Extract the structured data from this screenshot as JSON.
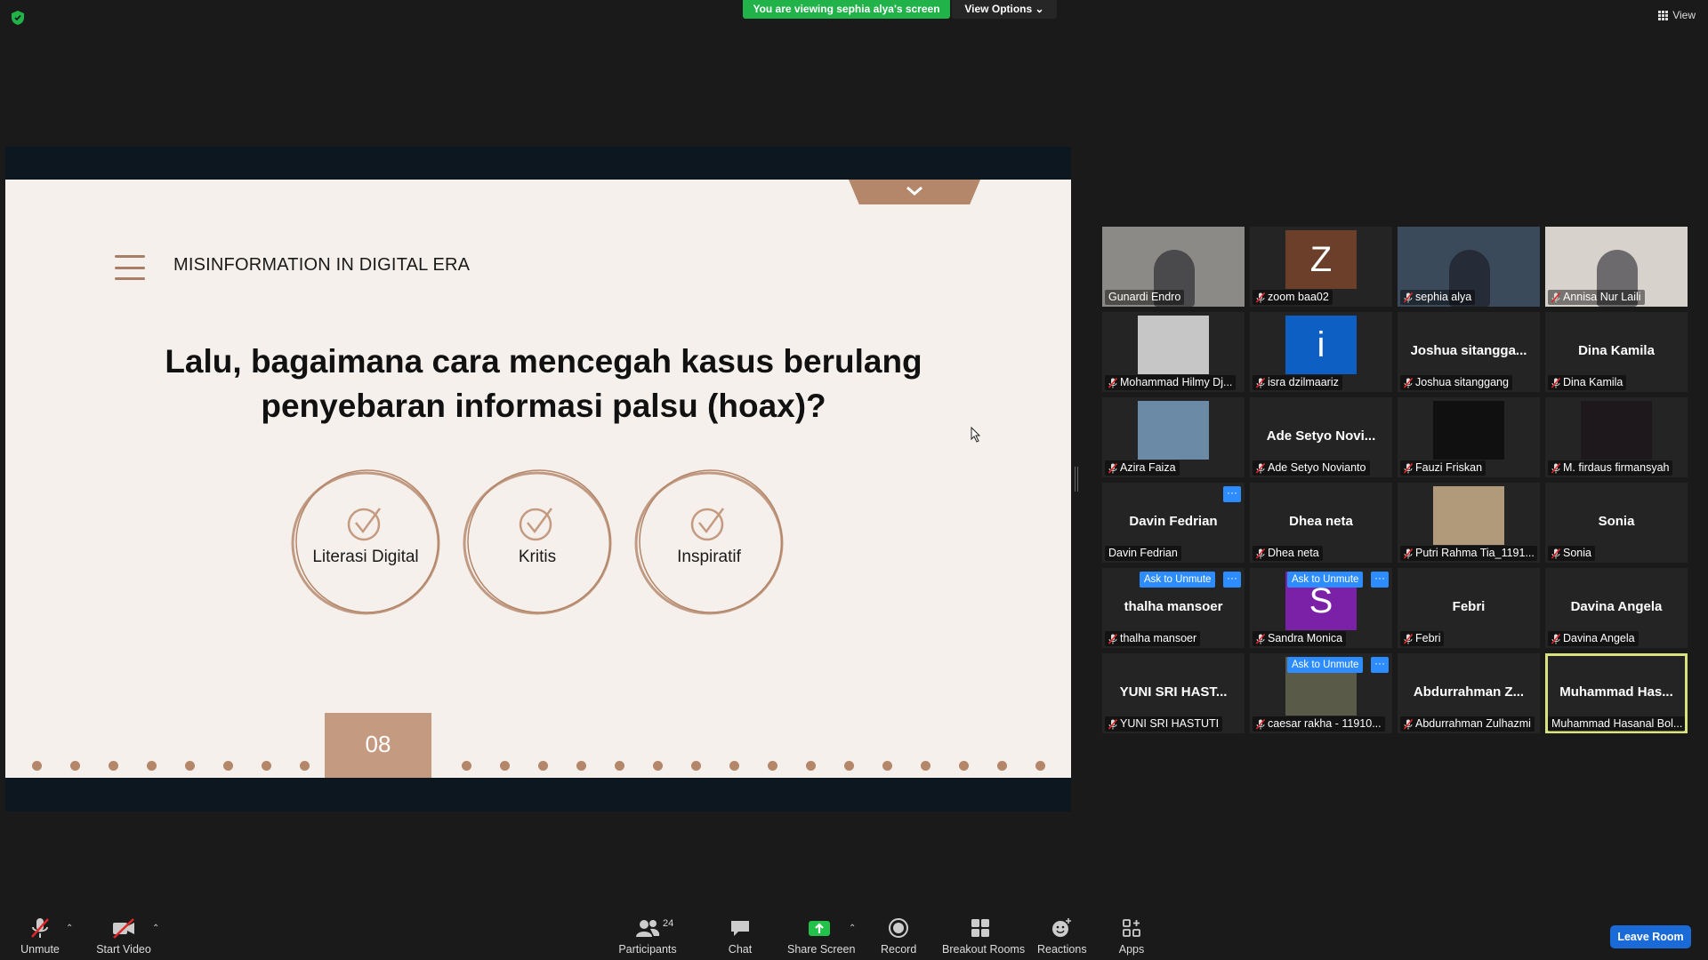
{
  "top_bar": {
    "viewing_banner": "You are viewing sephia alya's screen",
    "view_options": "View Options",
    "view_button": "View"
  },
  "slide": {
    "section_title": "MISINFORMATION IN DIGITAL ERA",
    "heading_line1": "Lalu, bagaimana cara mencegah kasus berulang",
    "heading_line2": "penyebaran informasi palsu (hoax)?",
    "options": [
      "Literasi Digital",
      "Kritis",
      "Inspiratif"
    ],
    "page_number": "08",
    "accent_color": "#b4876a"
  },
  "participants": [
    {
      "tile_name": "",
      "label": "Gunardi Endro",
      "muted": false,
      "video": true
    },
    {
      "tile_name": "",
      "label": "zoom baa02",
      "muted": true,
      "avatar_letter": "Z",
      "avatar_color": "#6b3f2a"
    },
    {
      "tile_name": "",
      "label": "sephia alya",
      "muted": true,
      "video": true
    },
    {
      "tile_name": "",
      "label": "Annisa Nur Laili",
      "muted": true,
      "video": true
    },
    {
      "tile_name": "",
      "label": "Mohammad Hilmy Dj...",
      "muted": true,
      "photo": true
    },
    {
      "tile_name": "",
      "label": "isra dzilmaariz",
      "muted": true,
      "avatar_letter": "i",
      "avatar_color": "#0e5fc4"
    },
    {
      "tile_name": "Joshua  sitangga...",
      "label": "Joshua sitanggang",
      "muted": true
    },
    {
      "tile_name": "Dina Kamila",
      "label": "Dina Kamila",
      "muted": true
    },
    {
      "tile_name": "",
      "label": "Azira Faiza",
      "muted": true,
      "photo": true
    },
    {
      "tile_name": "Ade Setyo Novi...",
      "label": "Ade Setyo Novianto",
      "muted": true
    },
    {
      "tile_name": "",
      "label": "Fauzi Friskan",
      "muted": true,
      "photo": true
    },
    {
      "tile_name": "",
      "label": "M. firdaus firmansyah",
      "muted": true,
      "photo": true
    },
    {
      "tile_name": "Davin Fedrian",
      "label": "Davin Fedrian",
      "muted": false,
      "more": true
    },
    {
      "tile_name": "Dhea neta",
      "label": "Dhea neta",
      "muted": true
    },
    {
      "tile_name": "",
      "label": "Putri Rahma Tia_1191...",
      "muted": true,
      "photo": true
    },
    {
      "tile_name": "Sonia",
      "label": "Sonia",
      "muted": true
    },
    {
      "tile_name": "thalha mansoer",
      "label": "thalha mansoer",
      "muted": true,
      "ask_unmute": "Ask to Unmute",
      "more": true
    },
    {
      "tile_name": "",
      "label": "Sandra Monica",
      "muted": true,
      "avatar_letter": "S",
      "avatar_color": "#7a21a8",
      "ask_unmute": "Ask to Unmute",
      "more": true
    },
    {
      "tile_name": "Febri",
      "label": "Febri",
      "muted": true
    },
    {
      "tile_name": "Davina Angela",
      "label": "Davina Angela",
      "muted": true
    },
    {
      "tile_name": "YUNI SRI HAST...",
      "label": "YUNI SRI HASTUTI",
      "muted": true
    },
    {
      "tile_name": "",
      "label": "caesar rakha - 11910...",
      "muted": true,
      "photo": true,
      "ask_unmute": "Ask to Unmute",
      "more": true
    },
    {
      "tile_name": "Abdurrahman  Z...",
      "label": "Abdurrahman Zulhazmi",
      "muted": true
    },
    {
      "tile_name": "Muhammad  Has...",
      "label": "Muhammad Hasanal Bol...",
      "muted": false,
      "active_speaker": true
    }
  ],
  "toolbar": {
    "unmute": "Unmute",
    "start_video": "Start Video",
    "participants": "Participants",
    "participants_count": "24",
    "chat": "Chat",
    "share_screen": "Share Screen",
    "record": "Record",
    "breakout_rooms": "Breakout Rooms",
    "reactions": "Reactions",
    "apps": "Apps",
    "leave_room": "Leave Room"
  },
  "colors": {
    "banner_green": "#21b24a",
    "zoom_blue": "#2d8cff",
    "leave_blue": "#1a6ad8",
    "active_speaker_border": "#d8e37d"
  }
}
